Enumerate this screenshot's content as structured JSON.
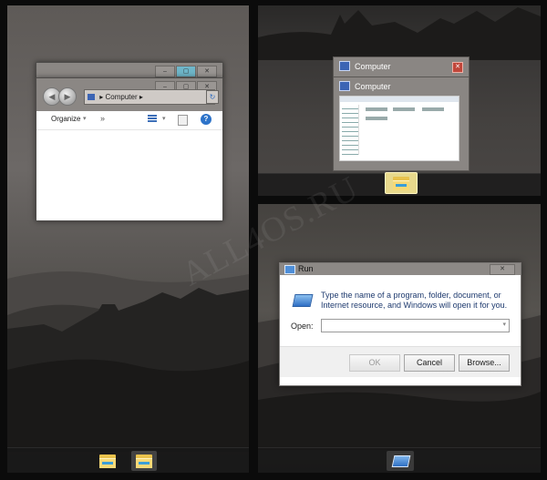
{
  "watermark": "ALL4OS.RU",
  "explorer": {
    "address_path": "Computer",
    "toolbar": {
      "organize_label": "Organize",
      "more_label": "»"
    },
    "caption_glyphs": [
      "–",
      "▢",
      "✕"
    ]
  },
  "switcher": {
    "items": [
      {
        "title": "Computer"
      },
      {
        "title": "Computer"
      }
    ]
  },
  "run_dialog": {
    "title": "Run",
    "description": "Type the name of a program, folder, document, or Internet resource, and Windows will open it for you.",
    "open_label": "Open:",
    "open_value": "",
    "buttons": {
      "ok": "OK",
      "cancel": "Cancel",
      "browse": "Browse..."
    }
  },
  "icons": {
    "taskbar_left": [
      "folder-icon",
      "folder-icon"
    ],
    "taskbar_top_right": [
      "folder-icon"
    ],
    "taskbar_bottom_right": [
      "run-icon"
    ]
  },
  "colors": {
    "accent_highlight": "#e8d98c",
    "maximize_button": "#6fb6c9",
    "close_button": "#c0463a"
  }
}
